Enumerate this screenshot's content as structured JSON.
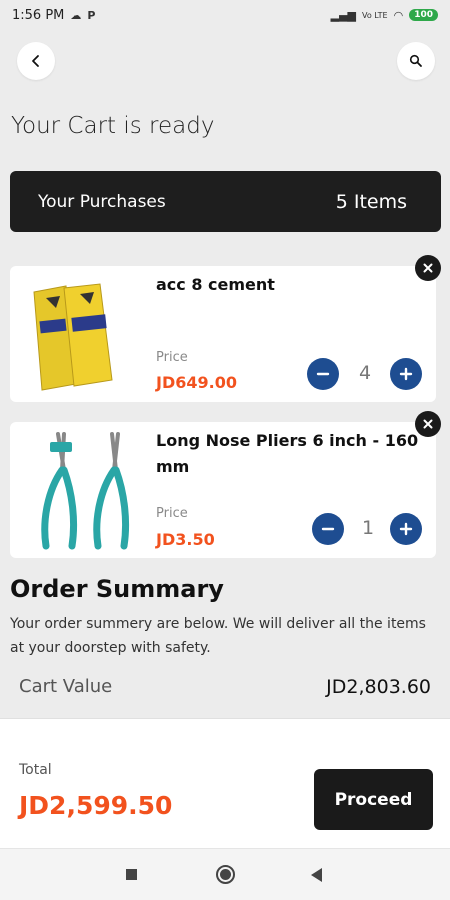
{
  "status_bar": {
    "time": "1:56 PM",
    "carrier_icon": "P",
    "battery": "100"
  },
  "header": {
    "title": "Your Cart is ready"
  },
  "purchases": {
    "label": "Your Purchases",
    "count": "5 Items"
  },
  "items": [
    {
      "name": "acc 8 cement",
      "price_label": "Price",
      "price": "JD649.00",
      "quantity": "4"
    },
    {
      "name": "Long Nose Pliers 6 inch - 160 mm",
      "price_label": "Price",
      "price": "JD3.50",
      "quantity": "1"
    }
  ],
  "summary": {
    "title": "Order Summary",
    "description": "Your order summery are below. We will deliver all the items at your doorstep with safety.",
    "cart_value_label": "Cart Value",
    "cart_value": "JD2,803.60"
  },
  "footer": {
    "total_label": "Total",
    "total": "JD2,599.50",
    "proceed_label": "Proceed"
  },
  "colors": {
    "accent": "#f2521e",
    "qty_button": "#1e4d91",
    "dark": "#1a1a1a"
  }
}
